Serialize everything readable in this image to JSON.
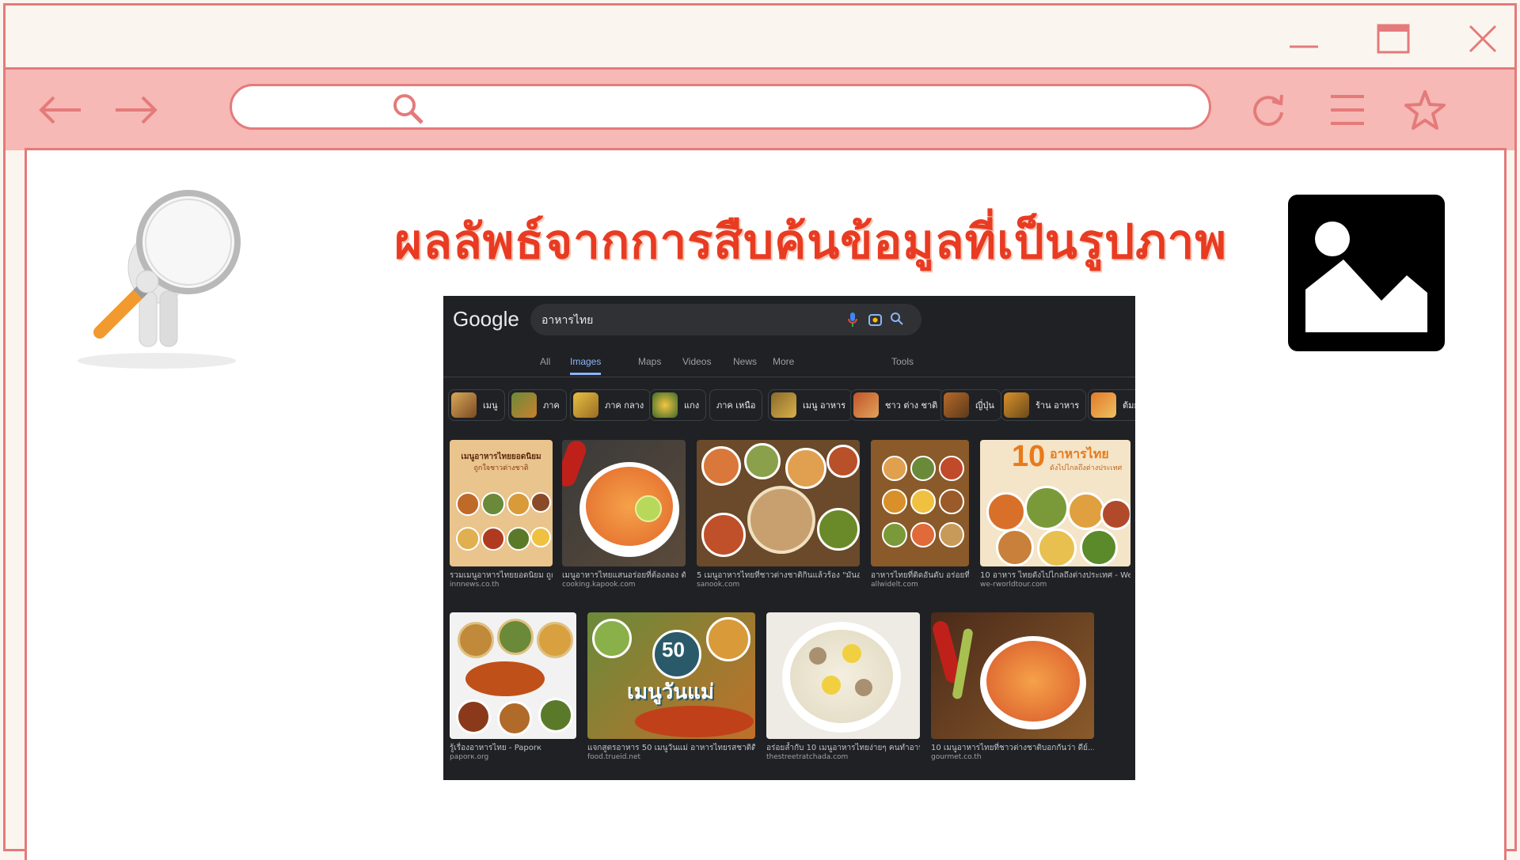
{
  "window": {
    "controls": [
      "minimize-icon",
      "maximize-icon",
      "close-icon"
    ]
  },
  "navbar": {
    "url_value": "",
    "icons": [
      "back-arrow-icon",
      "forward-arrow-icon",
      "search-icon",
      "refresh-icon",
      "menu-icon",
      "star-icon"
    ]
  },
  "headline": "ผลลัพธ์จากการสืบค้นข้อมูลที่เป็นรูปภาพ",
  "google": {
    "logo": "Google",
    "query": "อาหารไทย",
    "tabs": [
      "All",
      "Images",
      "Maps",
      "Videos",
      "News",
      "More",
      "Tools"
    ],
    "active_tab": "Images",
    "chips": [
      "เมนู",
      "ภาค",
      "ภาค กลาง",
      "แกง",
      "ภาค เหนือ",
      "เมนู อาหาร",
      "ชาว ต่าง ชาติ",
      "ญี่ปุ่น",
      "ร้าน อาหาร",
      "ต้มย"
    ],
    "row1": [
      {
        "caption": "รวมเมนูอาหารไทยยอดนิยม ถูกใ...",
        "source": "innnews.co.th"
      },
      {
        "caption": "เมนูอาหารไทยแสนอร่อยที่ต้องลอง ตัดโดย...",
        "source": "cooking.kapook.com"
      },
      {
        "caption": "5 เมนูอาหารไทยที่ชาวต่างชาติกินแล้วร้อง \"มันอร่อยมม...",
        "source": "sanook.com"
      },
      {
        "caption": "อาหารไทยที่ติดอันดับ อร่อยที่สุ...",
        "source": "allwidelt.com"
      },
      {
        "caption": "10 อาหาร ไทยดังไปไกลถึงต่างประเทศ - We R...",
        "source": "we-rworldtour.com"
      }
    ],
    "row2": [
      {
        "caption": "รู้เรื่องอาหารไทย - Paporк",
        "source": "paporк.org"
      },
      {
        "caption": "แจกสูตรอาหาร 50 เมนูวันแม่ อาหารไทยรสชาติดี ที่คุณแ...",
        "source": "food.trueid.net"
      },
      {
        "caption": "อร่อยล้ำกับ 10 เมนูอาหารไทยง่ายๆ คนทำอาหารไม่...",
        "source": "thestreetratchada.com"
      },
      {
        "caption": "10 เมนูอาหารไทยที่ชาวต่างชาติบอกกันว่า ดีย์... - G...",
        "source": "gourmet.co.th"
      }
    ],
    "overlay_texts": {
      "badge_10": "10",
      "badge_10_text": "อาหารไทย",
      "badge_10_sub": "ดังไปไกลถึงต่างประเทศ",
      "badge_50": "50",
      "badge_50_text": "เมนูวันแม่",
      "thumb1_title": "เมนูอาหารไทยยอดนิยม",
      "thumb1_sub": "ถูกใจชาวต่างชาติ"
    }
  },
  "colors": {
    "frame": "#e57a7a",
    "navbar": "#f6b9b5",
    "headline": "#e83b22",
    "google_bg": "#202124"
  }
}
